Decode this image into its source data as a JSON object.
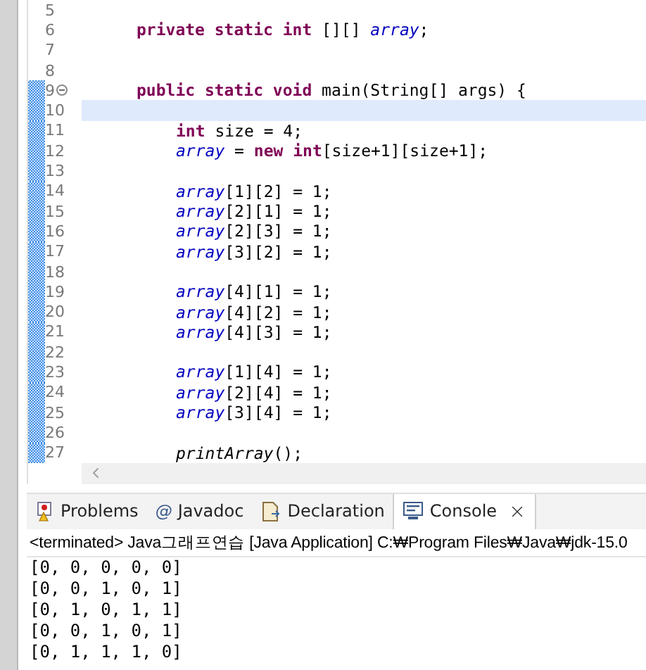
{
  "editor": {
    "lines": [
      {
        "number": "5",
        "changed": false,
        "current": false,
        "fold": false
      },
      {
        "number": "6",
        "changed": false,
        "current": false,
        "fold": false,
        "kind": "member",
        "tokens": [
          {
            "text": "private static int",
            "kind": "keyword"
          },
          {
            "text": " [][] ",
            "kind": "plain"
          },
          {
            "text": "array",
            "kind": "field"
          },
          {
            "text": ";",
            "kind": "plain"
          }
        ]
      },
      {
        "number": "7",
        "changed": false,
        "current": false,
        "fold": false
      },
      {
        "number": "8",
        "changed": false,
        "current": false,
        "fold": false
      },
      {
        "number": "9",
        "changed": true,
        "current": false,
        "fold": true,
        "kind": "member",
        "tokens": [
          {
            "text": "public static void",
            "kind": "keyword"
          },
          {
            "text": " main(String[] args) {",
            "kind": "plain"
          }
        ]
      },
      {
        "number": "10",
        "changed": true,
        "current": true,
        "fold": false
      },
      {
        "number": "11",
        "changed": true,
        "current": false,
        "fold": false,
        "kind": "statement",
        "tokens": [
          {
            "text": "int",
            "kind": "keyword"
          },
          {
            "text": " size = 4;",
            "kind": "plain"
          }
        ]
      },
      {
        "number": "12",
        "changed": true,
        "current": false,
        "fold": false,
        "kind": "statement",
        "tokens": [
          {
            "text": "array",
            "kind": "field"
          },
          {
            "text": " = ",
            "kind": "plain"
          },
          {
            "text": "new int",
            "kind": "keyword"
          },
          {
            "text": "[size+1][size+1];",
            "kind": "plain"
          }
        ]
      },
      {
        "number": "13",
        "changed": true,
        "current": false,
        "fold": false
      },
      {
        "number": "14",
        "changed": true,
        "current": false,
        "fold": false,
        "kind": "statement",
        "tokens": [
          {
            "text": "array",
            "kind": "field"
          },
          {
            "text": "[1][2] = 1;",
            "kind": "plain"
          }
        ]
      },
      {
        "number": "15",
        "changed": true,
        "current": false,
        "fold": false,
        "kind": "statement",
        "tokens": [
          {
            "text": "array",
            "kind": "field"
          },
          {
            "text": "[2][1] = 1;",
            "kind": "plain"
          }
        ]
      },
      {
        "number": "16",
        "changed": true,
        "current": false,
        "fold": false,
        "kind": "statement",
        "tokens": [
          {
            "text": "array",
            "kind": "field"
          },
          {
            "text": "[2][3] = 1;",
            "kind": "plain"
          }
        ]
      },
      {
        "number": "17",
        "changed": true,
        "current": false,
        "fold": false,
        "kind": "statement",
        "tokens": [
          {
            "text": "array",
            "kind": "field"
          },
          {
            "text": "[3][2] = 1;",
            "kind": "plain"
          }
        ]
      },
      {
        "number": "18",
        "changed": true,
        "current": false,
        "fold": false
      },
      {
        "number": "19",
        "changed": true,
        "current": false,
        "fold": false,
        "kind": "statement",
        "tokens": [
          {
            "text": "array",
            "kind": "field"
          },
          {
            "text": "[4][1] = 1;",
            "kind": "plain"
          }
        ]
      },
      {
        "number": "20",
        "changed": true,
        "current": false,
        "fold": false,
        "kind": "statement",
        "tokens": [
          {
            "text": "array",
            "kind": "field"
          },
          {
            "text": "[4][2] = 1;",
            "kind": "plain"
          }
        ]
      },
      {
        "number": "21",
        "changed": true,
        "current": false,
        "fold": false,
        "kind": "statement",
        "tokens": [
          {
            "text": "array",
            "kind": "field"
          },
          {
            "text": "[4][3] = 1;",
            "kind": "plain"
          }
        ]
      },
      {
        "number": "22",
        "changed": true,
        "current": false,
        "fold": false
      },
      {
        "number": "23",
        "changed": true,
        "current": false,
        "fold": false,
        "kind": "statement",
        "tokens": [
          {
            "text": "array",
            "kind": "field"
          },
          {
            "text": "[1][4] = 1;",
            "kind": "plain"
          }
        ]
      },
      {
        "number": "24",
        "changed": true,
        "current": false,
        "fold": false,
        "kind": "statement",
        "tokens": [
          {
            "text": "array",
            "kind": "field"
          },
          {
            "text": "[2][4] = 1;",
            "kind": "plain"
          }
        ]
      },
      {
        "number": "25",
        "changed": true,
        "current": false,
        "fold": false,
        "kind": "statement",
        "tokens": [
          {
            "text": "array",
            "kind": "field"
          },
          {
            "text": "[3][4] = 1;",
            "kind": "plain"
          }
        ]
      },
      {
        "number": "26",
        "changed": true,
        "current": false,
        "fold": false
      },
      {
        "number": "27",
        "changed": true,
        "current": false,
        "fold": false,
        "kind": "statement",
        "tokens": [
          {
            "text": "printArray",
            "kind": "method"
          },
          {
            "text": "();",
            "kind": "plain"
          }
        ]
      }
    ]
  },
  "tabs": [
    {
      "label": "Problems",
      "kind": "problems",
      "selected": false,
      "closable": false
    },
    {
      "label": "Javadoc",
      "kind": "javadoc",
      "icon_text": "@",
      "selected": false,
      "closable": false
    },
    {
      "label": "Declaration",
      "kind": "declaration",
      "selected": false,
      "closable": false
    },
    {
      "label": "Console",
      "kind": "console",
      "selected": true,
      "closable": true
    }
  ],
  "console": {
    "header": "<terminated> Java그래프연습 [Java Application] C:₩Program Files₩Java₩jdk-15.0",
    "output": [
      "[0, 0, 0, 0, 0]",
      "[0, 0, 1, 0, 1]",
      "[0, 1, 0, 1, 1]",
      "[0, 0, 1, 0, 1]",
      "[0, 1, 1, 1, 0]"
    ]
  }
}
